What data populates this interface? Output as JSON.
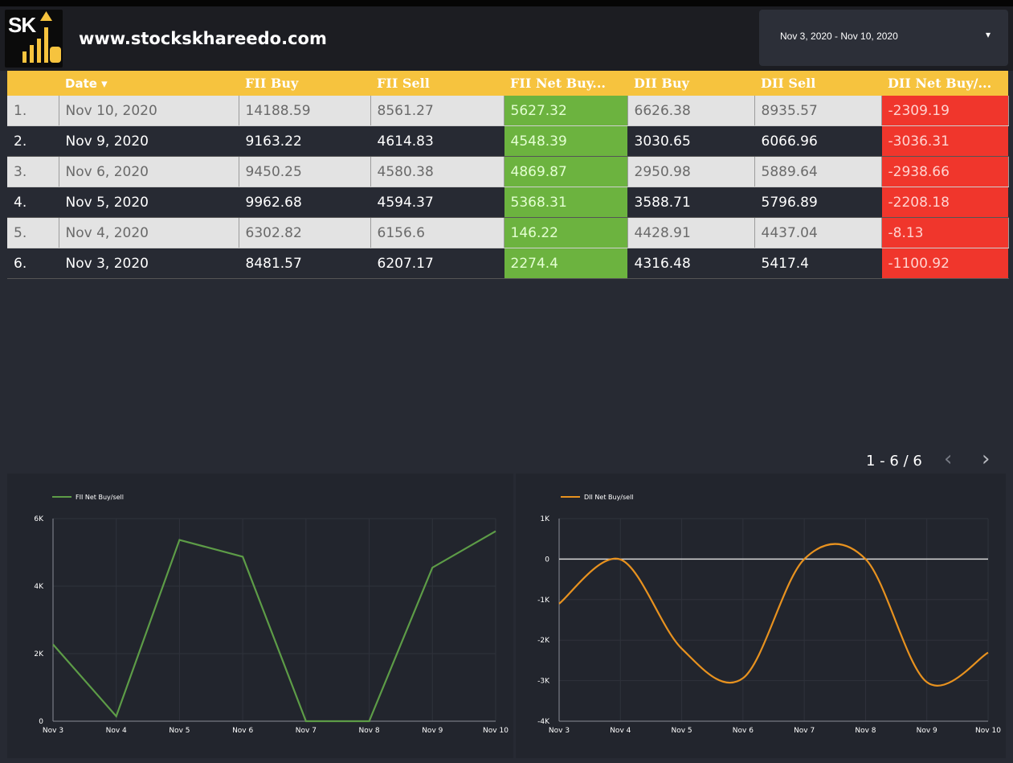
{
  "header": {
    "logo_text": "SK",
    "site": "www.stockskhareedo.com",
    "date_range": "Nov 3, 2020 - Nov 10, 2020",
    "date_caret": "▾"
  },
  "table": {
    "columns": [
      "",
      "Date ▾",
      "FII Buy",
      "FII Sell",
      "FII Net Buy...",
      "DII Buy",
      "DII Sell",
      "DII Net Buy/..."
    ],
    "rows": [
      [
        "1.",
        "Nov 10, 2020",
        "14188.59",
        "8561.27",
        "5627.32",
        "6626.38",
        "8935.57",
        "-2309.19"
      ],
      [
        "2.",
        "Nov 9, 2020",
        "9163.22",
        "4614.83",
        "4548.39",
        "3030.65",
        "6066.96",
        "-3036.31"
      ],
      [
        "3.",
        "Nov 6, 2020",
        "9450.25",
        "4580.38",
        "4869.87",
        "2950.98",
        "5889.64",
        "-2938.66"
      ],
      [
        "4.",
        "Nov 5, 2020",
        "9962.68",
        "4594.37",
        "5368.31",
        "3588.71",
        "5796.89",
        "-2208.18"
      ],
      [
        "5.",
        "Nov 4, 2020",
        "6302.82",
        "6156.6",
        "146.22",
        "4428.91",
        "4437.04",
        "-8.13"
      ],
      [
        "6.",
        "Nov 3, 2020",
        "8481.57",
        "6207.17",
        "2274.4",
        "4316.48",
        "5417.4",
        "-1100.92"
      ]
    ],
    "pagination": "1 - 6 / 6",
    "prev": "‹",
    "next": "›"
  },
  "colors": {
    "header_bg": "#f6c33e",
    "positive": "#6cb33f",
    "negative": "#f0362c",
    "fii_line": "#5d9c47",
    "dii_line": "#e8921f"
  },
  "chart_data": [
    {
      "type": "line",
      "series": [
        {
          "name": "FII Net Buy/sell",
          "values": [
            2274.4,
            146.22,
            5368.31,
            4869.87,
            0,
            0,
            4548.39,
            5627.32
          ]
        }
      ],
      "categories": [
        "Nov 3",
        "Nov 4",
        "Nov 5",
        "Nov 6",
        "Nov 7",
        "Nov 8",
        "Nov 9",
        "Nov 10"
      ],
      "yticks": [
        "0",
        "2K",
        "4K",
        "6K"
      ],
      "ylim": [
        0,
        6000
      ],
      "grid": true,
      "legend": "top-left"
    },
    {
      "type": "line",
      "series": [
        {
          "name": "DII Net Buy/sell",
          "values": [
            -1100.92,
            -8.13,
            -2208.18,
            -2938.66,
            0,
            0,
            -3036.31,
            -2309.19
          ]
        }
      ],
      "categories": [
        "Nov 3",
        "Nov 4",
        "Nov 5",
        "Nov 6",
        "Nov 7",
        "Nov 8",
        "Nov 9",
        "Nov 10"
      ],
      "yticks": [
        "-4K",
        "-3K",
        "-2K",
        "-1K",
        "0",
        "1K"
      ],
      "ylim": [
        -4000,
        1000
      ],
      "grid": true,
      "zero_line": true,
      "smooth": true,
      "legend": "top-left"
    }
  ]
}
